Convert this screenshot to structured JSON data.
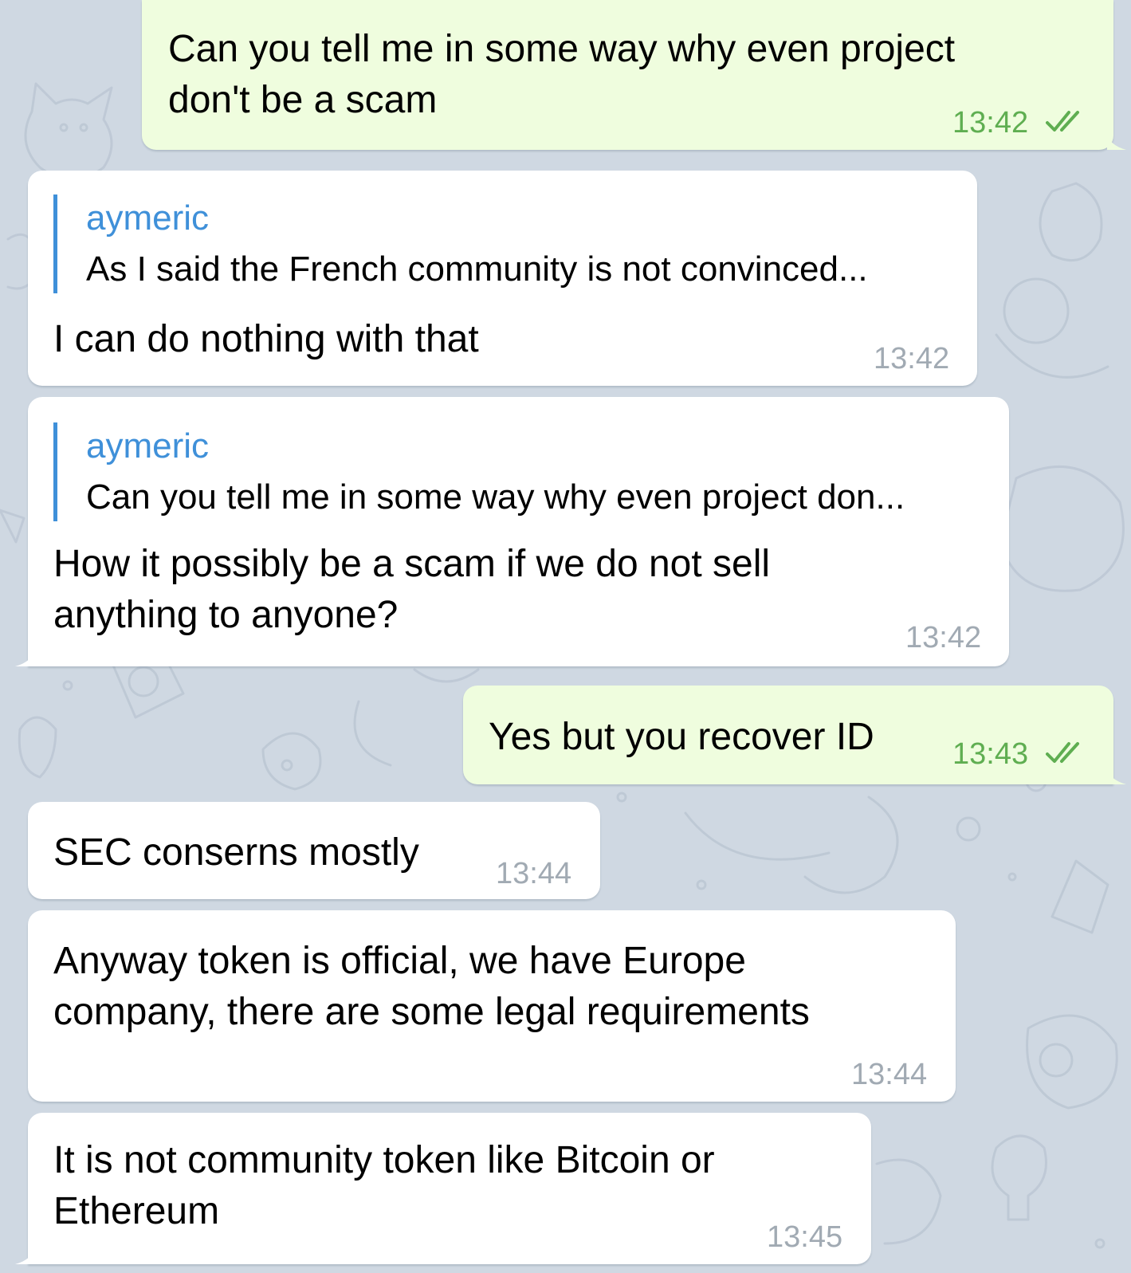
{
  "colors": {
    "background": "#cfd8e2",
    "incoming_bubble": "#ffffff",
    "outgoing_bubble": "#effdde",
    "incoming_time": "#a1aab3",
    "outgoing_time": "#5fae51",
    "reply_accent": "#3f90d9"
  },
  "messages": [
    {
      "direction": "outgoing",
      "lines": [
        "Can you tell me in some way why even project",
        "don't be a scam"
      ],
      "time": "13:42",
      "status": "read",
      "status_icon": "double-check-icon"
    },
    {
      "direction": "incoming",
      "reply": {
        "name": "aymeric",
        "text": "As I said the French community is not convinced..."
      },
      "lines": [
        "I can do nothing with that"
      ],
      "time": "13:42"
    },
    {
      "direction": "incoming",
      "reply": {
        "name": "aymeric",
        "text": "Can you tell me in some way why even project don..."
      },
      "lines": [
        "How it possibly be a scam if we do not sell",
        "anything to anyone?"
      ],
      "time": "13:42"
    },
    {
      "direction": "outgoing",
      "lines": [
        "Yes but you recover ID"
      ],
      "time": "13:43",
      "status": "read",
      "status_icon": "double-check-icon"
    },
    {
      "direction": "incoming",
      "lines": [
        "SEC conserns mostly"
      ],
      "time": "13:44"
    },
    {
      "direction": "incoming",
      "lines": [
        "Anyway token is official, we have Europe",
        "company, there are some legal requirements"
      ],
      "time": "13:44"
    },
    {
      "direction": "incoming",
      "lines": [
        "It is not community token like Bitcoin or",
        "Ethereum"
      ],
      "time": "13:45"
    }
  ]
}
